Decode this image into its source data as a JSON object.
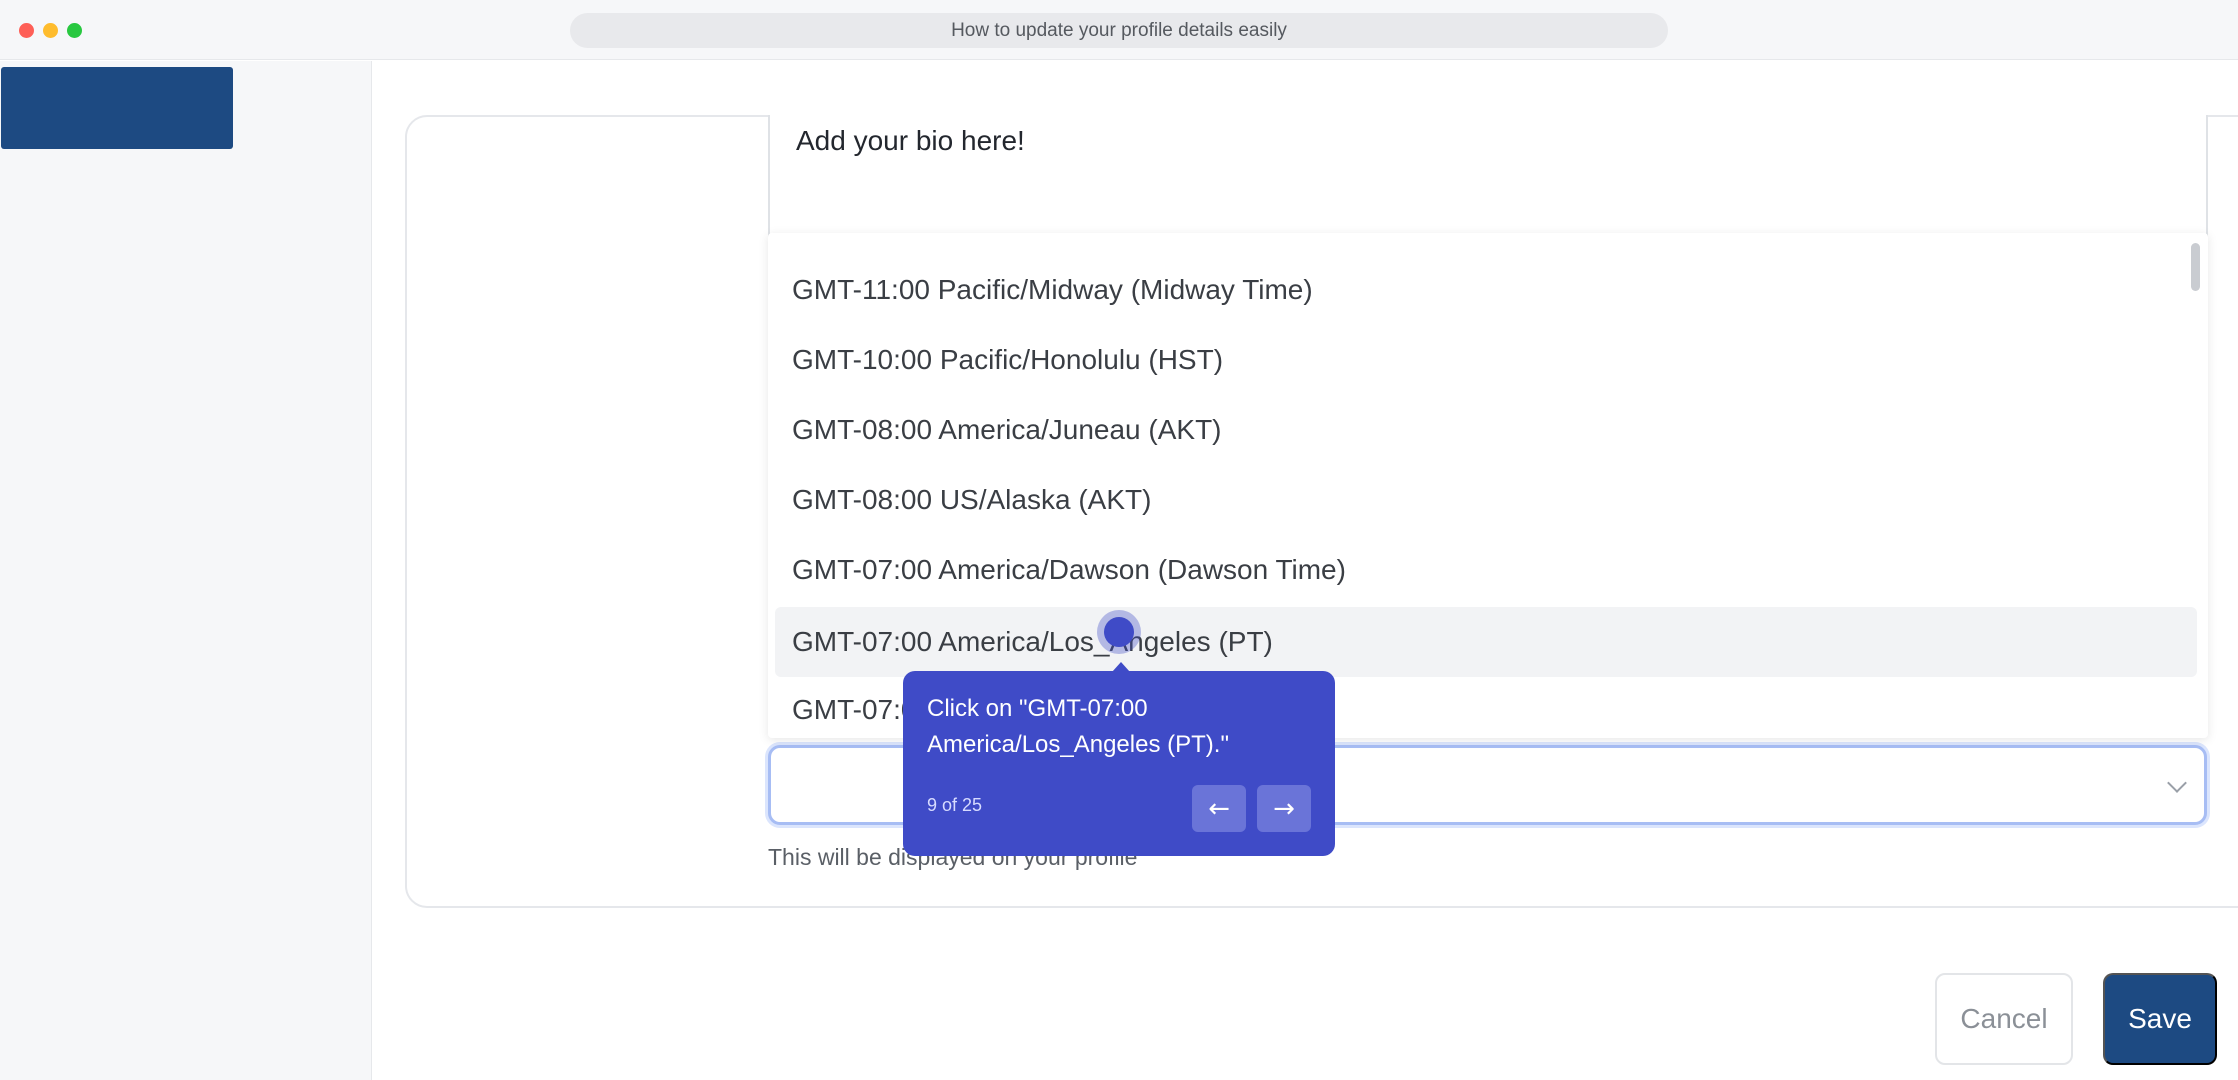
{
  "window": {
    "title": "How to update your profile details easily"
  },
  "form": {
    "bio_text": "Add your bio here!",
    "helper_text": "This will be displayed on your profile",
    "timezone_value": ""
  },
  "dropdown": {
    "options": [
      "GMT-11:00 Pacific/Midway (Midway Time)",
      "GMT-10:00 Pacific/Honolulu (HST)",
      "GMT-08:00 America/Juneau (AKT)",
      "GMT-08:00 US/Alaska (AKT)",
      "GMT-07:00 America/Dawson (Dawson Time)",
      "GMT-07:00 America/Los_Angeles (PT)",
      "GMT-07:00"
    ],
    "highlighted_index": 5
  },
  "tooltip": {
    "text": "Click on \"GMT-07:00 America/Los_Angeles (PT).\"",
    "counter": "9 of 25",
    "prev_icon": "arrow-left-icon",
    "next_icon": "arrow-right-icon",
    "background": "#3f4bc7"
  },
  "actions": {
    "cancel_label": "Cancel",
    "save_label": "Save"
  },
  "colors": {
    "brand": "#1d4a82",
    "accent": "#3f4bc7"
  }
}
